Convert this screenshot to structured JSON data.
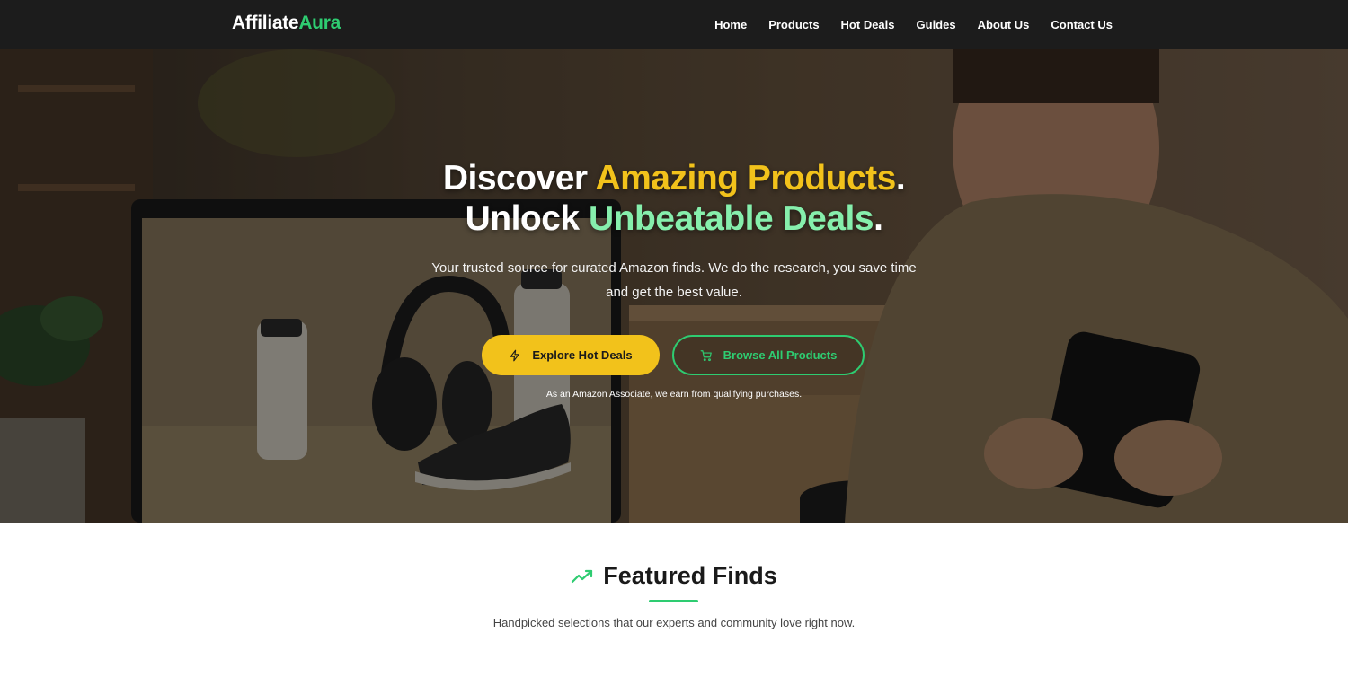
{
  "brand": {
    "name_part1": "Affiliate",
    "name_part2": "Aura"
  },
  "nav": {
    "items": [
      {
        "label": "Home"
      },
      {
        "label": "Products"
      },
      {
        "label": "Hot Deals"
      },
      {
        "label": "Guides"
      },
      {
        "label": "About Us"
      },
      {
        "label": "Contact Us"
      }
    ]
  },
  "hero": {
    "line1_a": "Discover ",
    "line1_b": "Amazing Products",
    "line1_c": ".",
    "line2_a": "Unlock ",
    "line2_b": "Unbeatable Deals",
    "line2_c": ".",
    "subtitle": "Your trusted source for curated Amazon finds. We do the research, you save time and get the best value.",
    "primary_button": {
      "label": "Explore Hot Deals",
      "icon": "lightning-icon"
    },
    "secondary_button": {
      "label": "Browse All Products",
      "icon": "cart-icon"
    },
    "disclaimer": "As an Amazon Associate, we earn from qualifying purchases."
  },
  "featured": {
    "icon": "trending-up-icon",
    "title": "Featured Finds",
    "subtitle": "Handpicked selections that our experts and community love right now."
  },
  "colors": {
    "nav_bg": "#1c1c1c",
    "brand_accent": "#2ecc71",
    "yellow": "#f2c21b",
    "light_green": "#86efac"
  }
}
